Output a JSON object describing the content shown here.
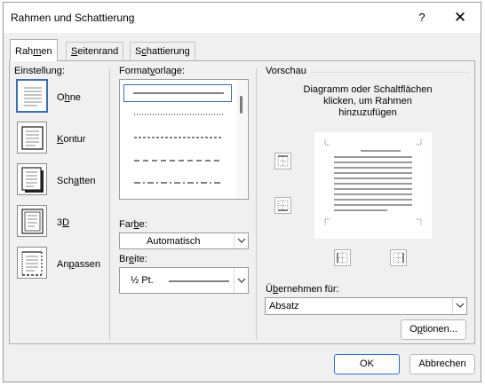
{
  "window": {
    "title": "Rahmen und Schattierung",
    "help_label": "?",
    "close_label": "✕"
  },
  "tabs": [
    {
      "pre": "Rah",
      "key": "m",
      "post": "en",
      "active": true
    },
    {
      "pre": "",
      "key": "S",
      "post": "eitenrand",
      "active": false
    },
    {
      "pre": "S",
      "key": "c",
      "post": "hattierung",
      "active": false
    }
  ],
  "settings": {
    "heading": "Einstellung:",
    "items": [
      {
        "pre": "O",
        "key": "h",
        "post": "ne",
        "icon": "setting-none-icon",
        "selected": true
      },
      {
        "pre": "",
        "key": "K",
        "post": "ontur",
        "icon": "setting-box-icon",
        "selected": false
      },
      {
        "pre": "Sch",
        "key": "a",
        "post": "tten",
        "icon": "setting-shadow-icon",
        "selected": false
      },
      {
        "pre": "3",
        "key": "D",
        "post": "",
        "icon": "setting-3d-icon",
        "selected": false
      },
      {
        "pre": "An",
        "key": "p",
        "post": "assen",
        "icon": "setting-custom-icon",
        "selected": false
      }
    ]
  },
  "style": {
    "heading_pre": "Format",
    "heading_key": "v",
    "heading_post": "orlage:",
    "items": [
      "solid",
      "dotted",
      "dashed-small",
      "dashed",
      "dash-dot"
    ],
    "selected_index": 0
  },
  "color": {
    "label_pre": "Far",
    "label_key": "b",
    "label_post": "e:",
    "value": "Automatisch"
  },
  "width": {
    "label_pre": "Br",
    "label_key": "e",
    "label_post": "ite:",
    "value": "½ Pt."
  },
  "preview": {
    "heading": "Vorschau",
    "instruction": "Diagramm oder Schaltflächen klicken, um Rahmen hinzuzufügen",
    "buttons": [
      "border-top-icon",
      "border-bottom-icon",
      "border-left-icon",
      "border-right-icon"
    ]
  },
  "apply_to": {
    "label_pre": "Ü",
    "label_key": "b",
    "label_post": "ernehmen für:",
    "value": "Absatz"
  },
  "options_button": {
    "pre": "O",
    "key": "p",
    "post": "tionen..."
  },
  "ok_button": "OK",
  "cancel_button": "Abbrechen",
  "colors": {
    "accent": "#3c6fb4",
    "dialog_bg": "#f0f0f0",
    "panel_border": "#adadad"
  }
}
